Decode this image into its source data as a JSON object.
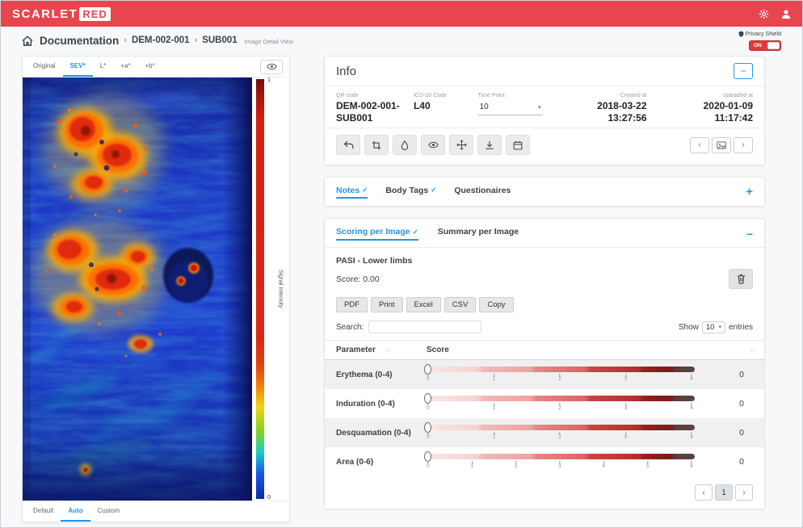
{
  "app": {
    "brand": "SCARLET",
    "brand_badge": "RED",
    "accent_blue": "#2196f3",
    "header_red": "#e8464e"
  },
  "icons": {
    "minus": "−",
    "plus": "+",
    "prev": "‹",
    "next": "›",
    "sort": "↑↓",
    "caret": "▾",
    "check": "✓",
    "sep": "›"
  },
  "breadcrumb": {
    "root": "Documentation",
    "subject": "DEM-002-001",
    "sub": "SUB001",
    "view": "Image Detail View"
  },
  "privacy_shield": {
    "label": "Privacy Shield",
    "state": "ON"
  },
  "viewer": {
    "tabs": [
      {
        "label": "Original"
      },
      {
        "label": "SEV*"
      },
      {
        "label": "L*"
      },
      {
        "label": "+a*"
      },
      {
        "label": "+b*"
      }
    ],
    "active_tab": "SEV*",
    "bottom_tabs": [
      {
        "label": "Default"
      },
      {
        "label": "Auto"
      },
      {
        "label": "Custom"
      }
    ],
    "active_bottom_tab": "Auto",
    "colorbar": {
      "top": "1",
      "bottom": "0",
      "axis": "Signal Intensity"
    }
  },
  "info": {
    "title": "Info",
    "qr": {
      "label": "QR code",
      "value": "DEM-002-001-SUB001"
    },
    "icd": {
      "label": "ICD-10 Code",
      "value": "L40"
    },
    "time_point": {
      "label": "Time Point",
      "value": "10"
    },
    "created": {
      "label": "Created at",
      "value": "2018-03-22 13:27:56"
    },
    "uploaded": {
      "label": "Uploaded at",
      "value": "2020-01-09 11:17:42"
    }
  },
  "notes": {
    "tabs": [
      {
        "label": "Notes",
        "check": "✓"
      },
      {
        "label": "Body Tags",
        "check": "✓"
      },
      {
        "label": "Questionaires",
        "check": ""
      }
    ],
    "active_tab": "Notes"
  },
  "scoring": {
    "tabs": [
      {
        "label": "Scoring per Image",
        "check": "✓"
      },
      {
        "label": "Summary per Image",
        "check": ""
      }
    ],
    "active_tab": "Scoring per Image",
    "section_title": "PASI - Lower limbs",
    "score_label": "Score: 0.00",
    "export_buttons": [
      "PDF",
      "Print",
      "Excel",
      "CSV",
      "Copy"
    ],
    "search_label": "Search:",
    "show": {
      "prefix": "Show",
      "value": "10",
      "suffix": "entries"
    },
    "table": {
      "columns": [
        "Parameter",
        "Score"
      ],
      "rows": [
        {
          "parameter": "Erythema (0-4)",
          "score": "0",
          "min": 0,
          "max": 4,
          "value": 0
        },
        {
          "parameter": "Induration (0-4)",
          "score": "0",
          "min": 0,
          "max": 4,
          "value": 0
        },
        {
          "parameter": "Desquamation (0-4)",
          "score": "0",
          "min": 0,
          "max": 4,
          "value": 0
        },
        {
          "parameter": "Area (0-6)",
          "score": "0",
          "min": 0,
          "max": 6,
          "value": 0
        }
      ]
    },
    "pagination": {
      "current": "1"
    }
  }
}
